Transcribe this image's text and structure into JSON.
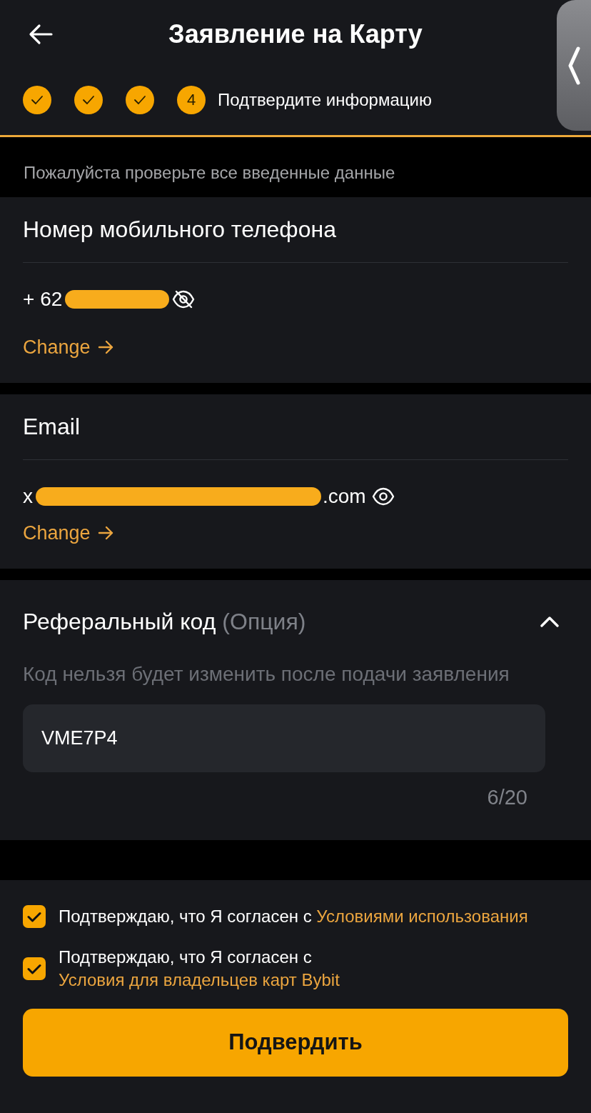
{
  "header": {
    "title": "Заявление на Карту"
  },
  "steps": [
    {
      "done": true
    },
    {
      "done": true
    },
    {
      "done": true
    },
    {
      "done": false,
      "number": "4",
      "label": "Подтвердите информацию"
    }
  ],
  "notice": "Пожалуйста проверьте все введенные данные",
  "phone_section": {
    "heading": "Номер мобильного телефона",
    "value_start": "+ 62",
    "redacted": true,
    "hidden": true,
    "change_link": "Change"
  },
  "email_section": {
    "heading": "Email",
    "value_start": "x",
    "value_end": ".com",
    "redacted": true,
    "hidden": false,
    "change_link": "Change"
  },
  "referral_section": {
    "heading": "Реферальный код",
    "heading_note": "(Опция)",
    "expanded": true,
    "hint": "Код нельзя будет изменить после подачи заявления",
    "input": {
      "value": "VME7P4"
    },
    "counter": "6/20"
  },
  "agreements": [
    {
      "checked": true,
      "text": "Подтверждаю, что Я согласен с",
      "link": "Условиями использования"
    },
    {
      "checked": true,
      "text": "Подтверждаю, что Я согласен с",
      "link": "Условия для владельцев карт Bybit"
    }
  ],
  "submit_button": {
    "label": "Подвердить"
  }
}
